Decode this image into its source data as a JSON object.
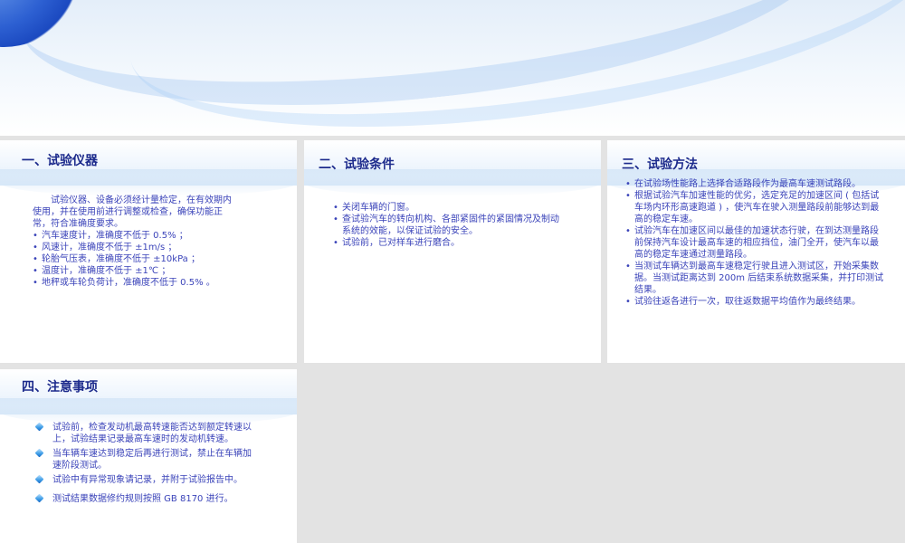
{
  "slides": [
    {
      "title": "一、试验仪器",
      "intro": "试验仪器、设备必须经计量检定，在有效期内使用，并在使用前进行调整或检查，确保功能正常，符合准确度要求。",
      "items": [
        "汽车速度计，准确度不低于 0.5% ；",
        "风速计，准确度不低于 ±1m/s ；",
        "轮胎气压表，准确度不低于 ±10kPa ；",
        "温度计，准确度不低于 ±1℃ ；",
        "地秤或车轮负荷计，准确度不低于 0.5% 。"
      ]
    },
    {
      "title": "二、试验条件",
      "items": [
        "关闭车辆的门窗。",
        "查试验汽车的转向机构、各部紧固件的紧固情况及制动系统的效能，以保证试验的安全。",
        "试验前，已对样车进行磨合。"
      ]
    },
    {
      "title": "三、试验方法",
      "items": [
        "在试验场性能路上选择合适路段作为最高车速测试路段。",
        "根据试验汽车加速性能的优劣，选定充足的加速区间 ( 包括试车场内环形高速跑道 ) ，使汽车在驶入测量路段前能够达到最高的稳定车速。",
        "试验汽车在加速区间以最佳的加速状态行驶，在到达测量路段前保持汽车设计最高车速的相应挡位，油门全开，使汽车以最高的稳定车速通过测量路段。",
        "当测试车辆达到最高车速稳定行驶且进入测试区，开始采集数据。当测试距离达到 200m 后结束系统数据采集，并打印测试结果。",
        "试验往返各进行一次，取往返数据平均值作为最终结果。"
      ]
    },
    {
      "title": "四、注意事项",
      "items": [
        "试验前，检查发动机最高转速能否达到额定转速以上，试验结果记录最高车速时的发动机转速。",
        "当车辆车速达到稳定后再进行测试，禁止在车辆加速阶段测试。",
        "试验中有异常现象请记录，并附于试验报告中。",
        "测试结果数据修约规则按照 GB 8170 进行。"
      ]
    }
  ]
}
